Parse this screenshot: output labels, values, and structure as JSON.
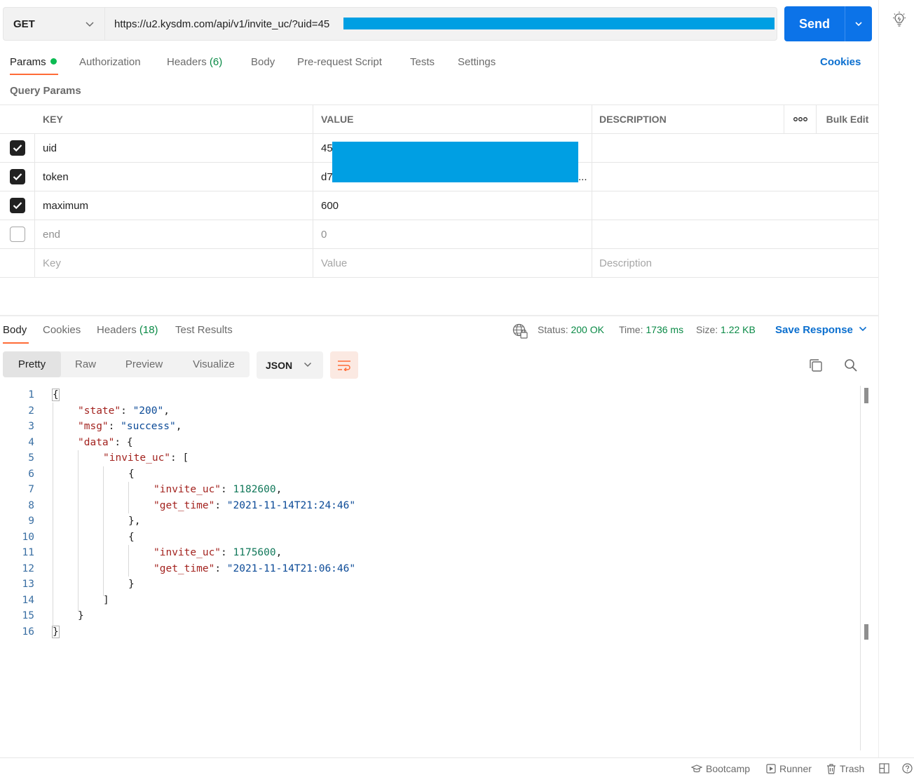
{
  "request": {
    "method": "GET",
    "url": "https://u2.kysdm.com/api/v1/invite_uc/?uid=45",
    "send_label": "Send"
  },
  "request_tabs": {
    "params": "Params",
    "authorization": "Authorization",
    "headers": "Headers",
    "headers_count": "(6)",
    "body": "Body",
    "prerequest": "Pre-request Script",
    "tests": "Tests",
    "settings": "Settings",
    "cookies": "Cookies"
  },
  "query_params": {
    "title": "Query Params",
    "columns": {
      "key": "KEY",
      "value": "VALUE",
      "description": "DESCRIPTION",
      "more": "ooo",
      "bulk_edit": "Bulk Edit"
    },
    "rows": [
      {
        "checked": true,
        "key": "uid",
        "value": "45",
        "description": ""
      },
      {
        "checked": true,
        "key": "token",
        "value": "d7",
        "value_tail": "...",
        "description": ""
      },
      {
        "checked": true,
        "key": "maximum",
        "value": "600",
        "description": ""
      },
      {
        "checked": false,
        "key": "end",
        "value": "0",
        "description": ""
      }
    ],
    "placeholders": {
      "key": "Key",
      "value": "Value",
      "description": "Description"
    }
  },
  "response_tabs": {
    "body": "Body",
    "cookies": "Cookies",
    "headers": "Headers",
    "headers_count": "(18)",
    "test_results": "Test Results"
  },
  "response_meta": {
    "status_label": "Status:",
    "status_value": "200 OK",
    "time_label": "Time:",
    "time_value": "1736 ms",
    "size_label": "Size:",
    "size_value": "1.22 KB",
    "save_response": "Save Response"
  },
  "view_modes": {
    "pretty": "Pretty",
    "raw": "Raw",
    "preview": "Preview",
    "visualize": "Visualize",
    "format": "JSON"
  },
  "code_lines": [
    {
      "n": "1",
      "indent": 0,
      "html": "{"
    },
    {
      "n": "2",
      "indent": 1,
      "key": "state",
      "str": "200",
      "comma": true
    },
    {
      "n": "3",
      "indent": 1,
      "key": "msg",
      "str": "success",
      "comma": true
    },
    {
      "n": "4",
      "indent": 1,
      "key": "data",
      "open": "{"
    },
    {
      "n": "5",
      "indent": 2,
      "key": "invite_uc",
      "open": "["
    },
    {
      "n": "6",
      "indent": 3,
      "html": "{"
    },
    {
      "n": "7",
      "indent": 4,
      "key": "invite_uc",
      "num": "1182600",
      "comma": true
    },
    {
      "n": "8",
      "indent": 4,
      "key": "get_time",
      "str": "2021-11-14T21:24:46"
    },
    {
      "n": "9",
      "indent": 3,
      "html": "},"
    },
    {
      "n": "10",
      "indent": 3,
      "html": "{"
    },
    {
      "n": "11",
      "indent": 4,
      "key": "invite_uc",
      "num": "1175600",
      "comma": true
    },
    {
      "n": "12",
      "indent": 4,
      "key": "get_time",
      "str": "2021-11-14T21:06:46"
    },
    {
      "n": "13",
      "indent": 3,
      "html": "}"
    },
    {
      "n": "14",
      "indent": 2,
      "html": "]"
    },
    {
      "n": "15",
      "indent": 1,
      "html": "}"
    },
    {
      "n": "16",
      "indent": 0,
      "html": "}"
    }
  ],
  "status_bar": {
    "bootcamp": "Bootcamp",
    "runner": "Runner",
    "trash": "Trash"
  },
  "colors": {
    "send": "#0c73e8",
    "accent": "#ff6c37",
    "link": "#0b6fcf",
    "status_ok": "#0a8a46",
    "redaction": "#009fe3"
  }
}
